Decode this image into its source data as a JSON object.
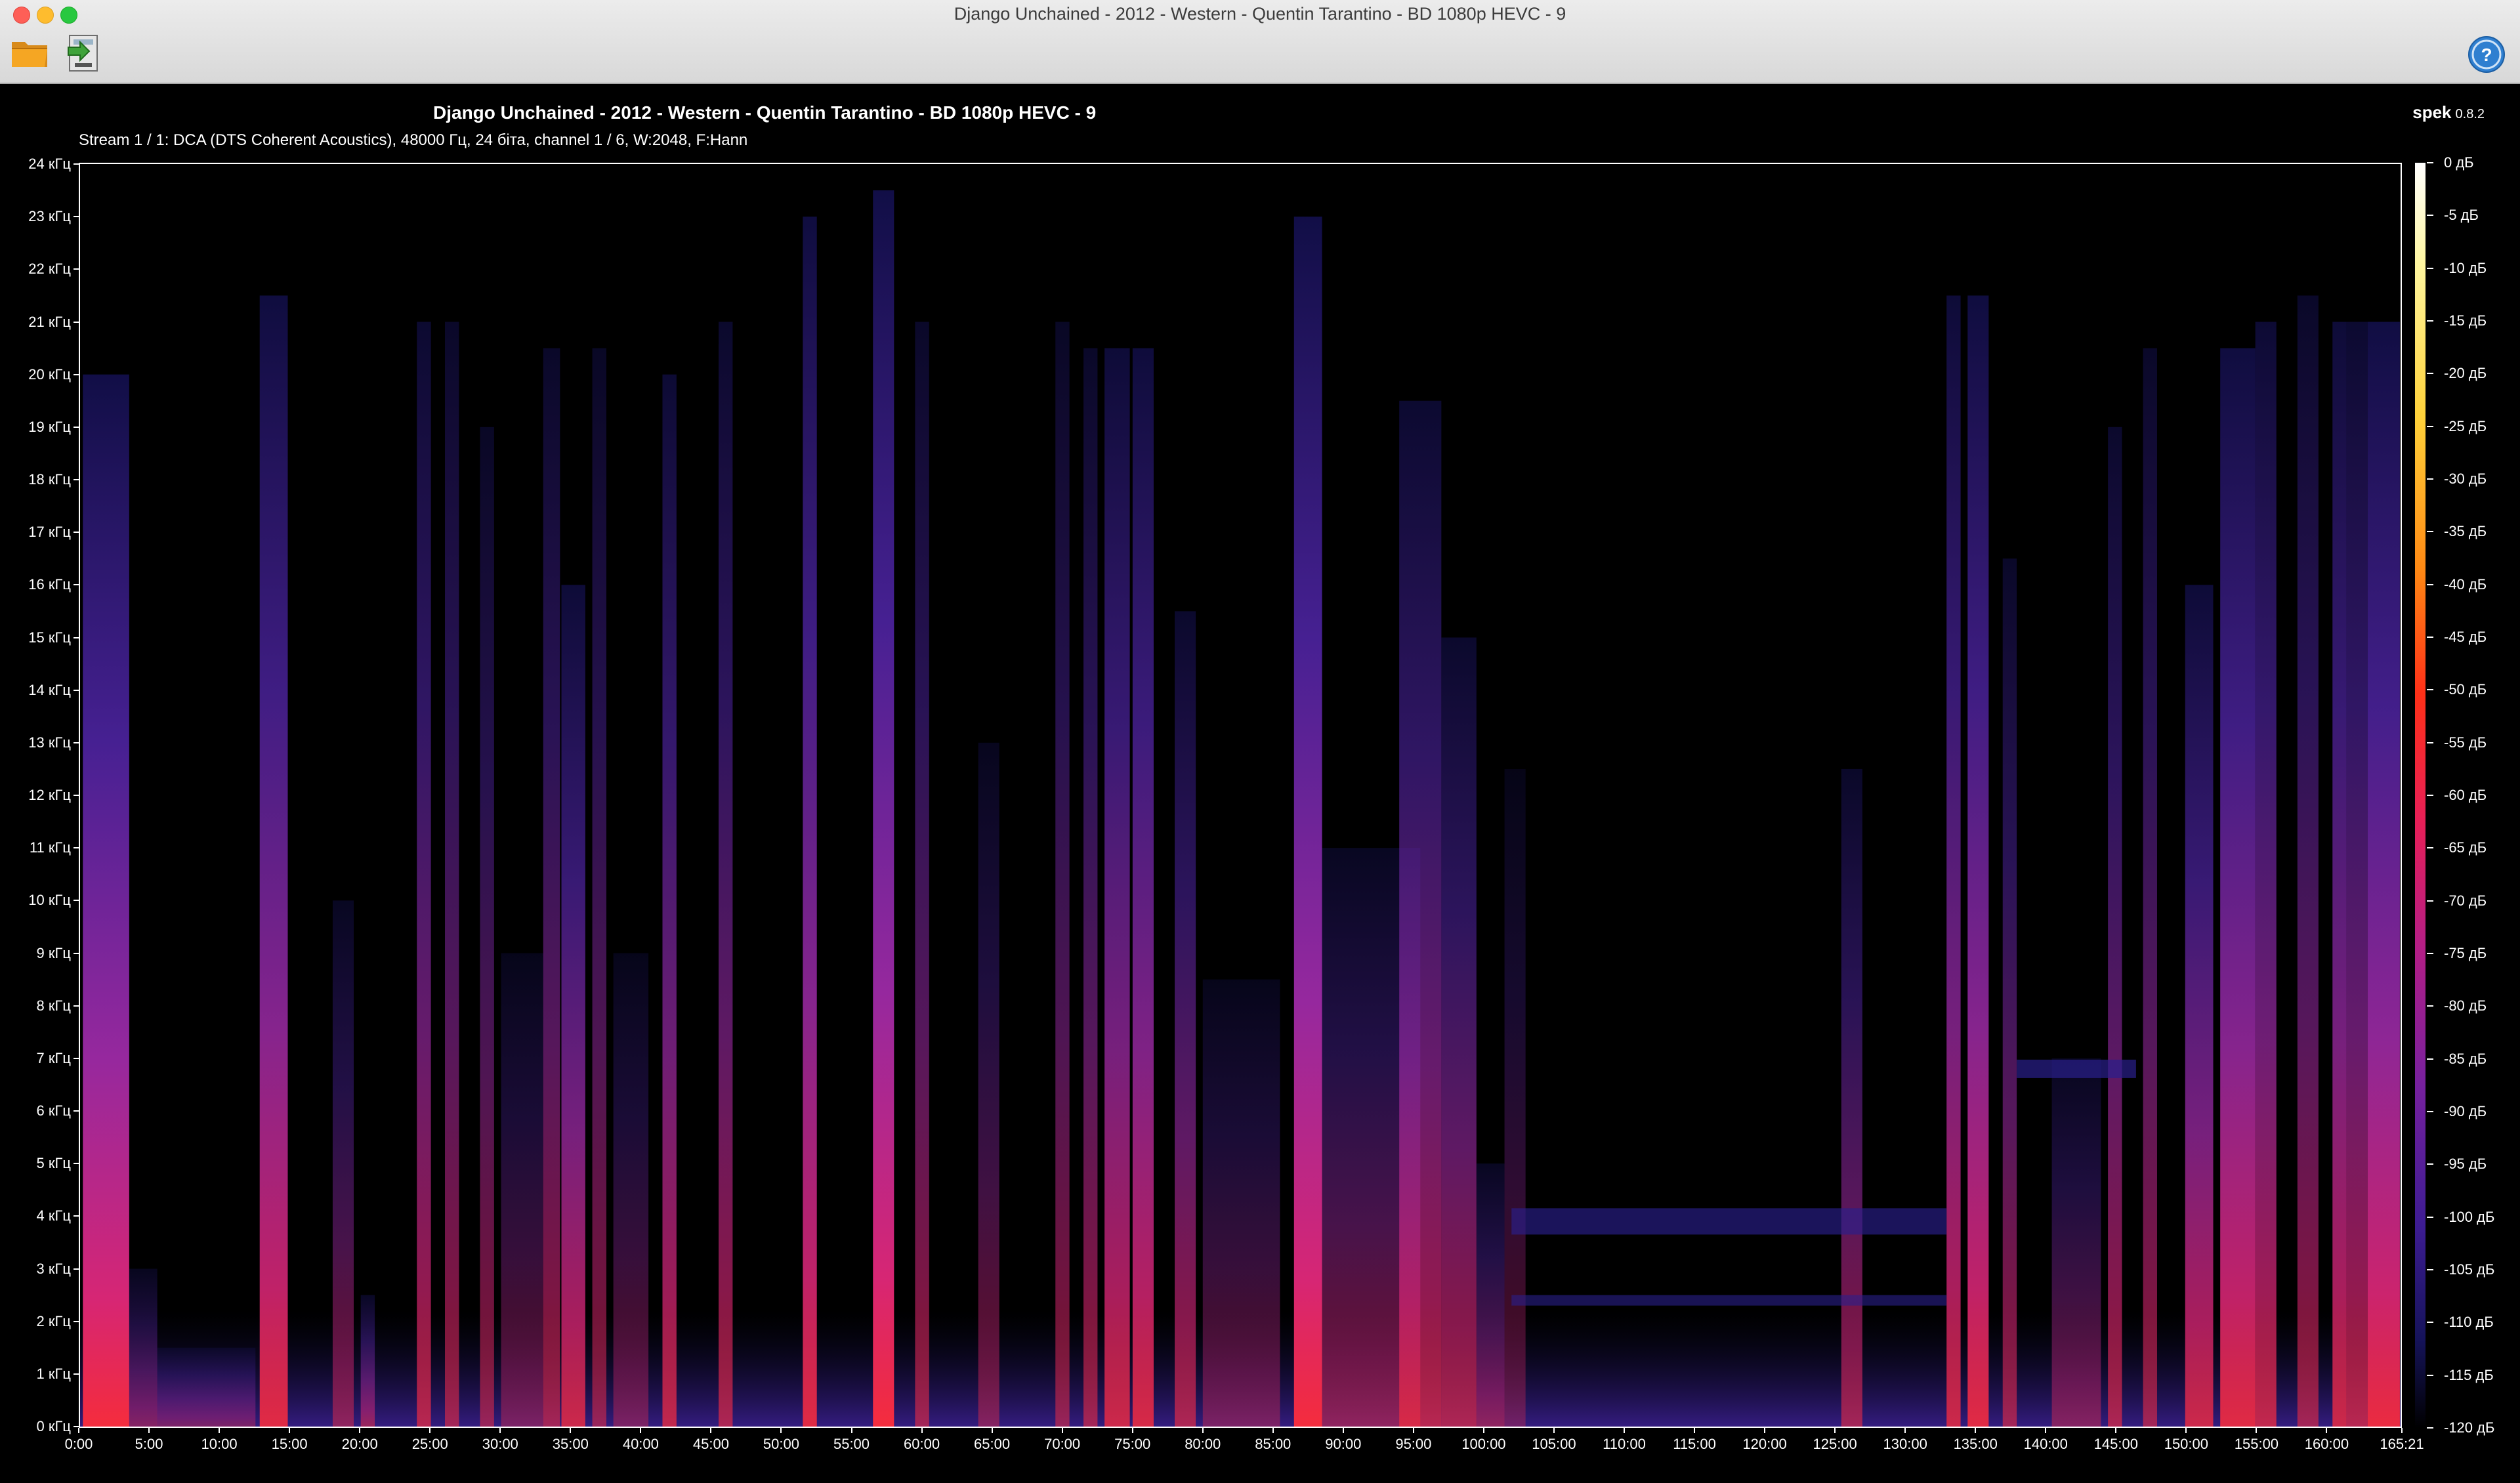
{
  "window": {
    "title": "Django Unchained  - 2012 - Western - Quentin Tarantino - BD 1080p HEVC - 9"
  },
  "toolbar": {
    "open_icon": "folder-open-icon",
    "save_icon": "save-icon",
    "help_icon": "help-icon"
  },
  "header": {
    "title": "Django Unchained  - 2012 - Western - Quentin Tarantino - BD 1080p HEVC - 9",
    "app_name": "spek",
    "app_version": "0.8.2",
    "stream_info": "Stream 1 / 1: DCA (DTS Coherent Acoustics), 48000 Гц, 24 біта, channel 1 / 6, W:2048, F:Hann"
  },
  "frequency_axis": {
    "labels": [
      "0 кГц",
      "1 кГц",
      "2 кГц",
      "3 кГц",
      "4 кГц",
      "5 кГц",
      "6 кГц",
      "7 кГц",
      "8 кГц",
      "9 кГц",
      "10 кГц",
      "11 кГц",
      "12 кГц",
      "13 кГц",
      "14 кГц",
      "15 кГц",
      "16 кГц",
      "17 кГц",
      "18 кГц",
      "19 кГц",
      "20 кГц",
      "21 кГц",
      "22 кГц",
      "23 кГц",
      "24 кГц"
    ],
    "range_khz": [
      0,
      24
    ]
  },
  "time_axis": {
    "labels": [
      "0:00",
      "5:00",
      "10:00",
      "15:00",
      "20:00",
      "25:00",
      "30:00",
      "35:00",
      "40:00",
      "45:00",
      "50:00",
      "55:00",
      "60:00",
      "65:00",
      "70:00",
      "75:00",
      "80:00",
      "85:00",
      "90:00",
      "95:00",
      "100:00",
      "105:00",
      "110:00",
      "115:00",
      "120:00",
      "125:00",
      "130:00",
      "135:00",
      "140:00",
      "145:00",
      "150:00",
      "155:00",
      "160:00",
      "165:21"
    ],
    "duration_min": 165.35
  },
  "colorbar": {
    "labels": [
      "0 дБ",
      "-5 дБ",
      "-10 дБ",
      "-15 дБ",
      "-20 дБ",
      "-25 дБ",
      "-30 дБ",
      "-35 дБ",
      "-40 дБ",
      "-45 дБ",
      "-50 дБ",
      "-55 дБ",
      "-60 дБ",
      "-65 дБ",
      "-70 дБ",
      "-75 дБ",
      "-80 дБ",
      "-85 дБ",
      "-90 дБ",
      "-95 дБ",
      "-100 дБ",
      "-105 дБ",
      "-110 дБ",
      "-115 дБ",
      "-120 дБ"
    ],
    "range_db": [
      -120,
      0
    ]
  },
  "colors": {
    "bright": "#ff2d3a",
    "magenta": "#d02a90",
    "purple": "#7a26a8",
    "blue": "#2a1f8c",
    "dark_blue": "#120f4a"
  },
  "spectrogram_bands": [
    {
      "t0": 0.2,
      "t1": 3.5,
      "fmax": 20,
      "level": 0.95
    },
    {
      "t0": 3.5,
      "t1": 5.5,
      "fmax": 3,
      "level": 0.4
    },
    {
      "t0": 5.5,
      "t1": 12.5,
      "fmax": 1.5,
      "level": 0.35
    },
    {
      "t0": 12.8,
      "t1": 14.8,
      "fmax": 21.5,
      "level": 0.85
    },
    {
      "t0": 18.0,
      "t1": 19.5,
      "fmax": 10,
      "level": 0.45
    },
    {
      "t0": 20.0,
      "t1": 21.0,
      "fmax": 2.5,
      "level": 0.5
    },
    {
      "t0": 24.0,
      "t1": 25.0,
      "fmax": 21,
      "level": 0.65
    },
    {
      "t0": 26.0,
      "t1": 27.0,
      "fmax": 21,
      "level": 0.55
    },
    {
      "t0": 28.5,
      "t1": 29.5,
      "fmax": 19,
      "level": 0.5
    },
    {
      "t0": 30.0,
      "t1": 33.0,
      "fmax": 9,
      "level": 0.35
    },
    {
      "t0": 33.0,
      "t1": 34.2,
      "fmax": 20.5,
      "level": 0.55
    },
    {
      "t0": 34.3,
      "t1": 36.0,
      "fmax": 16,
      "level": 0.75
    },
    {
      "t0": 36.5,
      "t1": 37.5,
      "fmax": 20.5,
      "level": 0.5
    },
    {
      "t0": 38.0,
      "t1": 40.5,
      "fmax": 9,
      "level": 0.35
    },
    {
      "t0": 41.5,
      "t1": 42.5,
      "fmax": 20,
      "level": 0.7
    },
    {
      "t0": 45.5,
      "t1": 46.5,
      "fmax": 21,
      "level": 0.6
    },
    {
      "t0": 51.5,
      "t1": 52.5,
      "fmax": 23,
      "level": 0.85
    },
    {
      "t0": 56.5,
      "t1": 58.0,
      "fmax": 23.5,
      "level": 0.95
    },
    {
      "t0": 59.5,
      "t1": 60.5,
      "fmax": 21,
      "level": 0.55
    },
    {
      "t0": 64.0,
      "t1": 65.5,
      "fmax": 13,
      "level": 0.4
    },
    {
      "t0": 69.5,
      "t1": 70.5,
      "fmax": 21,
      "level": 0.5
    },
    {
      "t0": 71.5,
      "t1": 72.5,
      "fmax": 20.5,
      "level": 0.55
    },
    {
      "t0": 73.0,
      "t1": 74.8,
      "fmax": 20.5,
      "level": 0.75
    },
    {
      "t0": 75.0,
      "t1": 76.5,
      "fmax": 20.5,
      "level": 0.8
    },
    {
      "t0": 78.0,
      "t1": 79.5,
      "fmax": 15.5,
      "level": 0.6
    },
    {
      "t0": 80.0,
      "t1": 85.5,
      "fmax": 8.5,
      "level": 0.35
    },
    {
      "t0": 86.5,
      "t1": 88.5,
      "fmax": 23,
      "level": 0.95
    },
    {
      "t0": 88.5,
      "t1": 95.5,
      "fmax": 11,
      "level": 0.45
    },
    {
      "t0": 94.0,
      "t1": 97.0,
      "fmax": 19.5,
      "level": 0.65
    },
    {
      "t0": 97.0,
      "t1": 99.5,
      "fmax": 15,
      "level": 0.6
    },
    {
      "t0": 99.5,
      "t1": 101.5,
      "fmax": 5,
      "level": 0.45
    },
    {
      "t0": 101.5,
      "t1": 103.0,
      "fmax": 12.5,
      "level": 0.3
    },
    {
      "t0": 125.5,
      "t1": 127.0,
      "fmax": 12.5,
      "level": 0.55
    },
    {
      "t0": 133.0,
      "t1": 134.0,
      "fmax": 21.5,
      "level": 0.75
    },
    {
      "t0": 134.5,
      "t1": 136.0,
      "fmax": 21.5,
      "level": 0.85
    },
    {
      "t0": 137.0,
      "t1": 138.0,
      "fmax": 16.5,
      "level": 0.55
    },
    {
      "t0": 140.5,
      "t1": 144.0,
      "fmax": 7,
      "level": 0.4
    },
    {
      "t0": 144.5,
      "t1": 145.5,
      "fmax": 19,
      "level": 0.6
    },
    {
      "t0": 147.0,
      "t1": 148.0,
      "fmax": 20.5,
      "level": 0.55
    },
    {
      "t0": 150.0,
      "t1": 152.0,
      "fmax": 16,
      "level": 0.75
    },
    {
      "t0": 152.5,
      "t1": 155.0,
      "fmax": 20.5,
      "level": 0.85
    },
    {
      "t0": 155.0,
      "t1": 156.5,
      "fmax": 21,
      "level": 0.7
    },
    {
      "t0": 158.0,
      "t1": 159.5,
      "fmax": 21.5,
      "level": 0.55
    },
    {
      "t0": 160.5,
      "t1": 161.5,
      "fmax": 21,
      "level": 0.75
    },
    {
      "t0": 161.5,
      "t1": 163.0,
      "fmax": 21,
      "level": 0.65
    },
    {
      "t0": 163.0,
      "t1": 165.3,
      "fmax": 21,
      "level": 0.9
    }
  ],
  "horizontal_bands": [
    {
      "t0": 102.0,
      "t1": 133.0,
      "freq_khz": 3.9,
      "thickness_khz": 0.5,
      "level": 0.35
    },
    {
      "t0": 102.0,
      "t1": 133.0,
      "freq_khz": 2.4,
      "thickness_khz": 0.2,
      "level": 0.3
    },
    {
      "t0": 138.0,
      "t1": 146.5,
      "freq_khz": 6.8,
      "thickness_khz": 0.35,
      "level": 0.4
    }
  ]
}
